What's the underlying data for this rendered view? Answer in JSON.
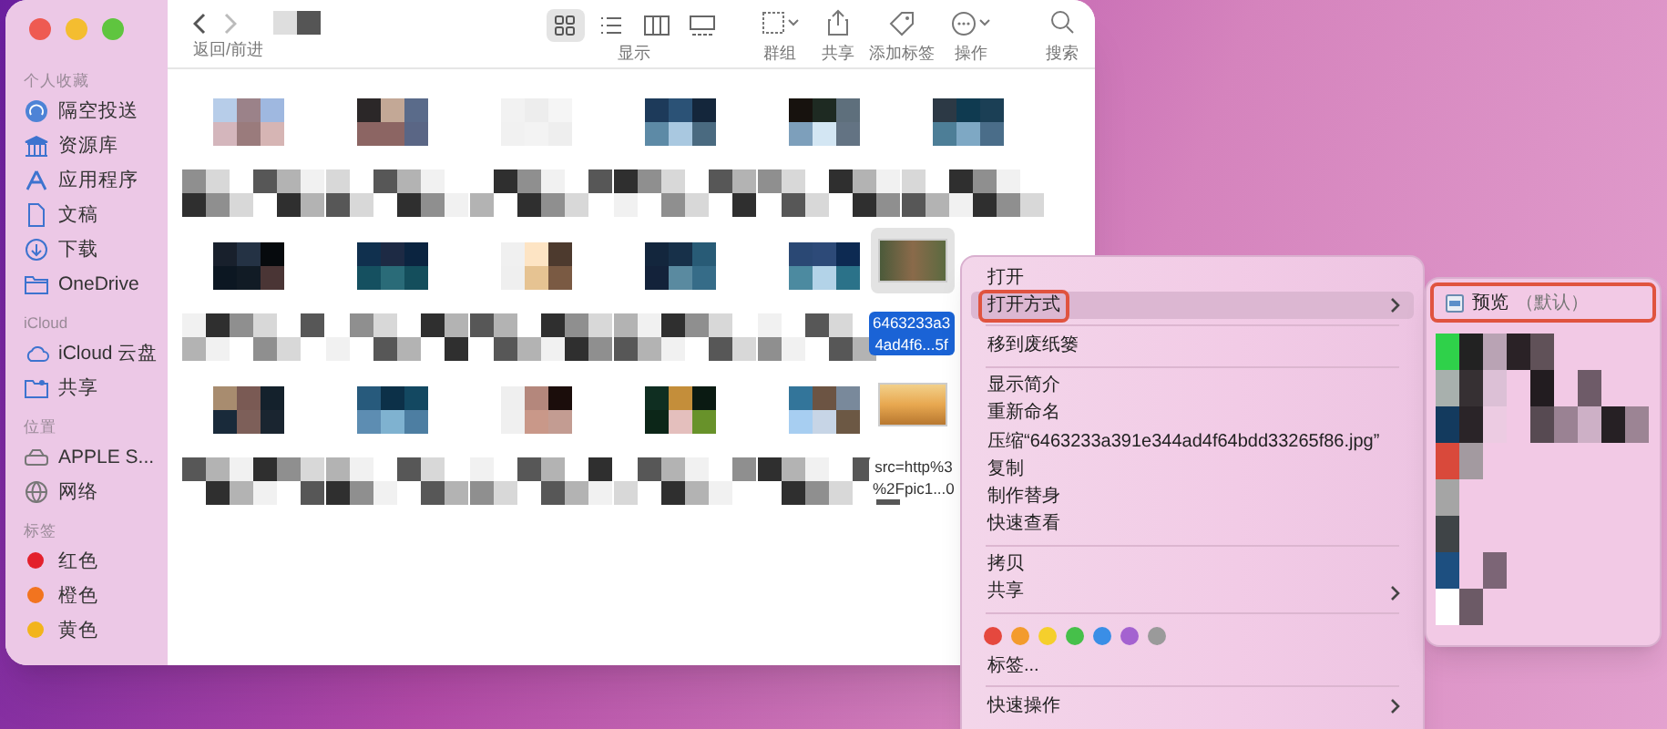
{
  "window": {
    "nav_label": "返回/前进",
    "view_label": "显示",
    "view_modes": [
      {
        "selected": true
      },
      {
        "selected": false
      },
      {
        "selected": false
      },
      {
        "selected": false
      }
    ],
    "toolbar": [
      {
        "kind": "group",
        "label": "群组"
      },
      {
        "kind": "share",
        "label": "共享"
      },
      {
        "kind": "tag",
        "label": "添加标签"
      },
      {
        "kind": "action",
        "label": "操作"
      },
      {
        "kind": "search",
        "label": "搜索"
      }
    ]
  },
  "sidebar": [
    {
      "heading": "个人收藏",
      "items": [
        {
          "kind": "airdrop",
          "label": "隔空投送"
        },
        {
          "kind": "library",
          "label": "资源库"
        },
        {
          "kind": "apps",
          "label": "应用程序"
        },
        {
          "kind": "doc",
          "label": "文稿"
        },
        {
          "kind": "download",
          "label": "下载"
        },
        {
          "kind": "folder",
          "label": "OneDrive"
        }
      ]
    },
    {
      "heading": "iCloud",
      "items": [
        {
          "kind": "cloud",
          "label": "iCloud 云盘"
        },
        {
          "kind": "shared",
          "label": "共享"
        }
      ]
    },
    {
      "heading": "位置",
      "items": [
        {
          "kind": "disk",
          "label": "APPLE S..."
        },
        {
          "kind": "globe",
          "label": "网络"
        }
      ]
    },
    {
      "heading": "标签",
      "items": [
        {
          "kind": "tag",
          "label": "红色",
          "color": "#e3202c"
        },
        {
          "kind": "tag",
          "label": "橙色",
          "color": "#f2741f"
        },
        {
          "kind": "tag",
          "label": "黄色",
          "color": "#f2b41c"
        }
      ]
    }
  ],
  "files": [
    {
      "name_lines": [
        "6463233a3",
        "4ad4f6...5f"
      ],
      "selected": true
    },
    {
      "name_lines": [
        "src=http%3",
        "%2Fpic1...0"
      ],
      "selected": false
    }
  ],
  "context_menu": {
    "groups": [
      [
        {
          "kind": "item",
          "label": "打开",
          "highlighted": false,
          "annotated": false
        },
        {
          "kind": "submenu",
          "label": "打开方式",
          "highlighted": true,
          "annotated": true
        }
      ],
      [
        {
          "kind": "item",
          "label": "移到废纸篓",
          "highlighted": false,
          "annotated": false
        }
      ],
      [
        {
          "kind": "item",
          "label": "显示简介",
          "highlighted": false,
          "annotated": false
        },
        {
          "kind": "item",
          "label": "重新命名",
          "highlighted": false,
          "annotated": false
        },
        {
          "kind": "item",
          "label": "压缩“6463233a391e344ad4f64bdd33265f86.jpg”",
          "highlighted": false,
          "annotated": false
        },
        {
          "kind": "item",
          "label": "复制",
          "highlighted": false,
          "annotated": false
        },
        {
          "kind": "item",
          "label": "制作替身",
          "highlighted": false,
          "annotated": false
        },
        {
          "kind": "item",
          "label": "快速查看",
          "highlighted": false,
          "annotated": false
        }
      ],
      [
        {
          "kind": "item",
          "label": "拷贝",
          "highlighted": false,
          "annotated": false
        },
        {
          "kind": "submenu",
          "label": "共享",
          "highlighted": false,
          "annotated": false
        }
      ],
      [
        {
          "kind": "colors",
          "colors": [
            {
              "color": "#e5483e"
            },
            {
              "color": "#f39b2d"
            },
            {
              "color": "#f5cf2c"
            },
            {
              "color": "#46c04a"
            },
            {
              "color": "#3a8ee6"
            },
            {
              "color": "#a462d0"
            },
            {
              "color": "#9a9a9a"
            }
          ]
        },
        {
          "kind": "item",
          "label": "标签...",
          "highlighted": false,
          "annotated": false
        }
      ],
      [
        {
          "kind": "submenu",
          "label": "快速操作",
          "highlighted": false,
          "annotated": false
        }
      ]
    ]
  },
  "submenu": {
    "items": [
      {
        "label": "预览",
        "note": "（默认）",
        "annotated": true
      }
    ]
  }
}
